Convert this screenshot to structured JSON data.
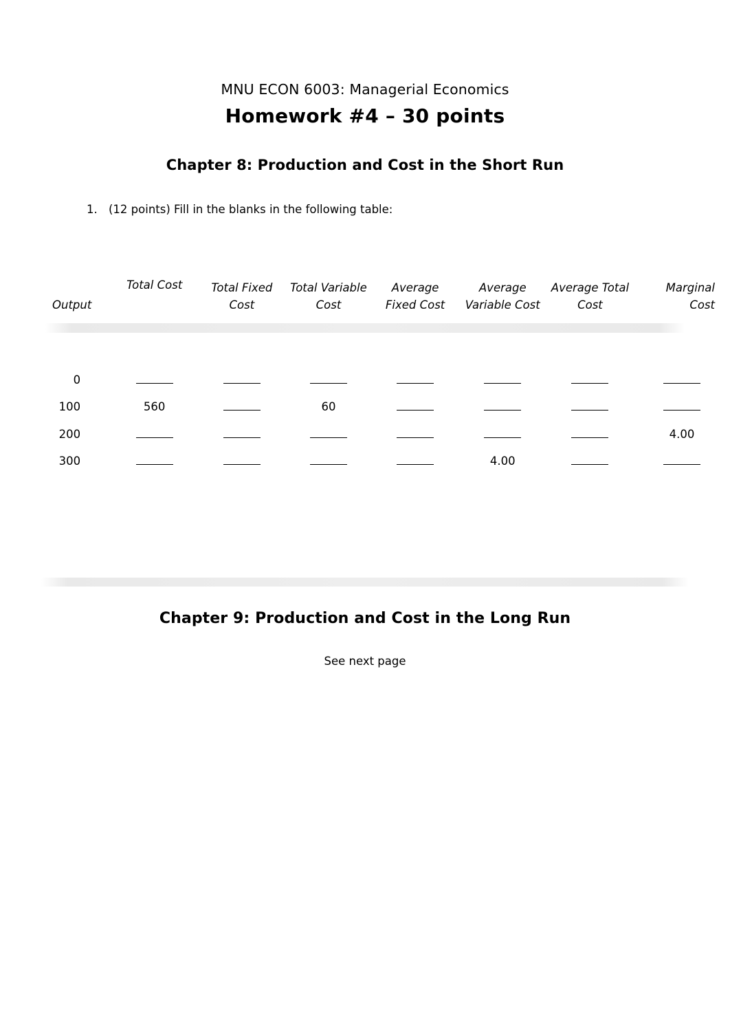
{
  "document": {
    "course_line": "MNU ECON 6003: Managerial Economics",
    "title": "Homework #4 – 30 points",
    "chapter8_heading": "Chapter 8: Production and Cost in the Short Run",
    "chapter9_heading": "Chapter 9: Production and Cost in the Long Run",
    "footer_note": "See next page"
  },
  "question1": {
    "number": "1.",
    "text": "(12 points) Fill in the blanks in the following table:"
  },
  "table": {
    "headers": {
      "output": "Output",
      "total_cost": "Total Cost",
      "total_fixed_cost": "Total Fixed Cost",
      "total_variable_cost": "Total Variable Cost",
      "average_fixed_cost": "Average Fixed Cost",
      "average_variable_cost": "Average Variable Cost",
      "average_total_cost": "Average Total Cost",
      "marginal_cost": "Marginal Cost"
    },
    "blank_marker": "_____",
    "rows": [
      {
        "output": "0",
        "total_cost": "",
        "total_fixed_cost": "",
        "total_variable_cost": "",
        "average_fixed_cost": "",
        "average_variable_cost": "",
        "average_total_cost": "",
        "marginal_cost": ""
      },
      {
        "output": "100",
        "total_cost": "560",
        "total_fixed_cost": "",
        "total_variable_cost": "60",
        "average_fixed_cost": "",
        "average_variable_cost": "",
        "average_total_cost": "",
        "marginal_cost": ""
      },
      {
        "output": "200",
        "total_cost": "",
        "total_fixed_cost": "",
        "total_variable_cost": "",
        "average_fixed_cost": "",
        "average_variable_cost": "",
        "average_total_cost": "",
        "marginal_cost": "4.00"
      },
      {
        "output": "300",
        "total_cost": "",
        "total_fixed_cost": "",
        "total_variable_cost": "",
        "average_fixed_cost": "",
        "average_variable_cost": "4.00",
        "average_total_cost": "",
        "marginal_cost": ""
      }
    ]
  }
}
